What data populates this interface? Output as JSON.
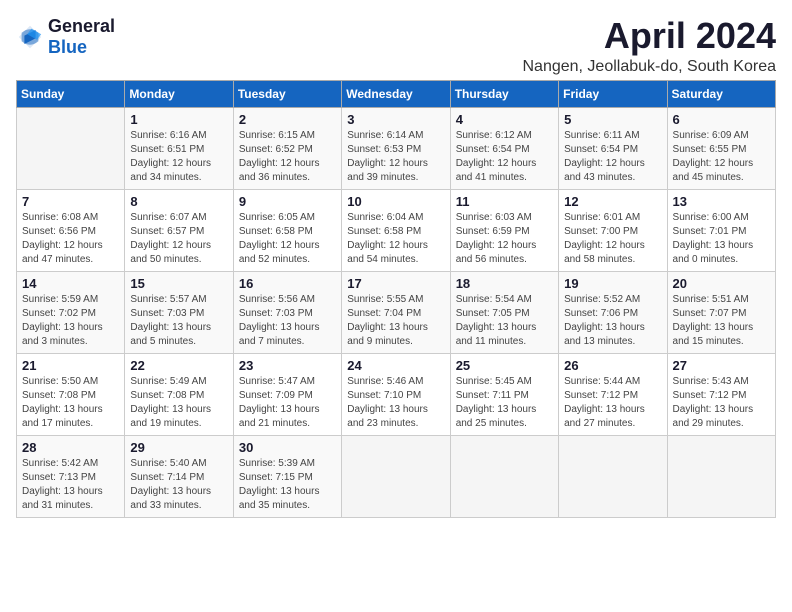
{
  "header": {
    "logo_general": "General",
    "logo_blue": "Blue",
    "title": "April 2024",
    "location": "Nangen, Jeollabuk-do, South Korea"
  },
  "days_of_week": [
    "Sunday",
    "Monday",
    "Tuesday",
    "Wednesday",
    "Thursday",
    "Friday",
    "Saturday"
  ],
  "weeks": [
    [
      {
        "day": "",
        "info": ""
      },
      {
        "day": "1",
        "info": "Sunrise: 6:16 AM\nSunset: 6:51 PM\nDaylight: 12 hours\nand 34 minutes."
      },
      {
        "day": "2",
        "info": "Sunrise: 6:15 AM\nSunset: 6:52 PM\nDaylight: 12 hours\nand 36 minutes."
      },
      {
        "day": "3",
        "info": "Sunrise: 6:14 AM\nSunset: 6:53 PM\nDaylight: 12 hours\nand 39 minutes."
      },
      {
        "day": "4",
        "info": "Sunrise: 6:12 AM\nSunset: 6:54 PM\nDaylight: 12 hours\nand 41 minutes."
      },
      {
        "day": "5",
        "info": "Sunrise: 6:11 AM\nSunset: 6:54 PM\nDaylight: 12 hours\nand 43 minutes."
      },
      {
        "day": "6",
        "info": "Sunrise: 6:09 AM\nSunset: 6:55 PM\nDaylight: 12 hours\nand 45 minutes."
      }
    ],
    [
      {
        "day": "7",
        "info": "Sunrise: 6:08 AM\nSunset: 6:56 PM\nDaylight: 12 hours\nand 47 minutes."
      },
      {
        "day": "8",
        "info": "Sunrise: 6:07 AM\nSunset: 6:57 PM\nDaylight: 12 hours\nand 50 minutes."
      },
      {
        "day": "9",
        "info": "Sunrise: 6:05 AM\nSunset: 6:58 PM\nDaylight: 12 hours\nand 52 minutes."
      },
      {
        "day": "10",
        "info": "Sunrise: 6:04 AM\nSunset: 6:58 PM\nDaylight: 12 hours\nand 54 minutes."
      },
      {
        "day": "11",
        "info": "Sunrise: 6:03 AM\nSunset: 6:59 PM\nDaylight: 12 hours\nand 56 minutes."
      },
      {
        "day": "12",
        "info": "Sunrise: 6:01 AM\nSunset: 7:00 PM\nDaylight: 12 hours\nand 58 minutes."
      },
      {
        "day": "13",
        "info": "Sunrise: 6:00 AM\nSunset: 7:01 PM\nDaylight: 13 hours\nand 0 minutes."
      }
    ],
    [
      {
        "day": "14",
        "info": "Sunrise: 5:59 AM\nSunset: 7:02 PM\nDaylight: 13 hours\nand 3 minutes."
      },
      {
        "day": "15",
        "info": "Sunrise: 5:57 AM\nSunset: 7:03 PM\nDaylight: 13 hours\nand 5 minutes."
      },
      {
        "day": "16",
        "info": "Sunrise: 5:56 AM\nSunset: 7:03 PM\nDaylight: 13 hours\nand 7 minutes."
      },
      {
        "day": "17",
        "info": "Sunrise: 5:55 AM\nSunset: 7:04 PM\nDaylight: 13 hours\nand 9 minutes."
      },
      {
        "day": "18",
        "info": "Sunrise: 5:54 AM\nSunset: 7:05 PM\nDaylight: 13 hours\nand 11 minutes."
      },
      {
        "day": "19",
        "info": "Sunrise: 5:52 AM\nSunset: 7:06 PM\nDaylight: 13 hours\nand 13 minutes."
      },
      {
        "day": "20",
        "info": "Sunrise: 5:51 AM\nSunset: 7:07 PM\nDaylight: 13 hours\nand 15 minutes."
      }
    ],
    [
      {
        "day": "21",
        "info": "Sunrise: 5:50 AM\nSunset: 7:08 PM\nDaylight: 13 hours\nand 17 minutes."
      },
      {
        "day": "22",
        "info": "Sunrise: 5:49 AM\nSunset: 7:08 PM\nDaylight: 13 hours\nand 19 minutes."
      },
      {
        "day": "23",
        "info": "Sunrise: 5:47 AM\nSunset: 7:09 PM\nDaylight: 13 hours\nand 21 minutes."
      },
      {
        "day": "24",
        "info": "Sunrise: 5:46 AM\nSunset: 7:10 PM\nDaylight: 13 hours\nand 23 minutes."
      },
      {
        "day": "25",
        "info": "Sunrise: 5:45 AM\nSunset: 7:11 PM\nDaylight: 13 hours\nand 25 minutes."
      },
      {
        "day": "26",
        "info": "Sunrise: 5:44 AM\nSunset: 7:12 PM\nDaylight: 13 hours\nand 27 minutes."
      },
      {
        "day": "27",
        "info": "Sunrise: 5:43 AM\nSunset: 7:12 PM\nDaylight: 13 hours\nand 29 minutes."
      }
    ],
    [
      {
        "day": "28",
        "info": "Sunrise: 5:42 AM\nSunset: 7:13 PM\nDaylight: 13 hours\nand 31 minutes."
      },
      {
        "day": "29",
        "info": "Sunrise: 5:40 AM\nSunset: 7:14 PM\nDaylight: 13 hours\nand 33 minutes."
      },
      {
        "day": "30",
        "info": "Sunrise: 5:39 AM\nSunset: 7:15 PM\nDaylight: 13 hours\nand 35 minutes."
      },
      {
        "day": "",
        "info": ""
      },
      {
        "day": "",
        "info": ""
      },
      {
        "day": "",
        "info": ""
      },
      {
        "day": "",
        "info": ""
      }
    ]
  ]
}
